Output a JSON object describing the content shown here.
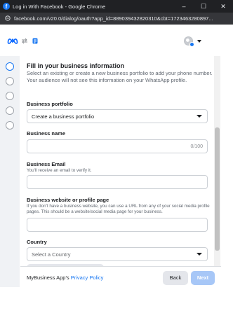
{
  "window": {
    "title": "Log in With Facebook - Google Chrome",
    "controls": {
      "minimize": "–",
      "maximize": "☐",
      "close": "✕"
    }
  },
  "browser": {
    "url": "facebook.com/v20.0/dialog/oauth?app_id=889039432820310&cbt=1723463280897..."
  },
  "header": {
    "logo": "meta-logo",
    "link_icon": "swap-arrows-icon",
    "app_icon": "business-app-icon",
    "account_icon": "avatar"
  },
  "stepper": {
    "steps": [
      {
        "state": "active"
      },
      {
        "state": "inactive"
      },
      {
        "state": "inactive"
      },
      {
        "state": "inactive"
      },
      {
        "state": "inactive"
      }
    ]
  },
  "form": {
    "heading": "Fill in your business information",
    "subtext": "Select an existing or create a new business portfolio to add your phone number. Your audience will not see this information on your WhatsApp profile.",
    "portfolio": {
      "label": "Business portfolio",
      "value": "Create a business portfolio"
    },
    "name": {
      "label": "Business name",
      "value": "",
      "counter": "0/100"
    },
    "email": {
      "label": "Business Email",
      "help": "You'll receive an email to verify it.",
      "value": ""
    },
    "website": {
      "label": "Business website or profile page",
      "help": "If you don't have a business website, you can use a URL from any of your social media profile pages. This should be a website/social media page for your business.",
      "value": ""
    },
    "country": {
      "label": "Country",
      "placeholder": "Select a Country"
    }
  },
  "footer": {
    "text": "MyBusiness App's ",
    "privacy_link": "Privacy Policy",
    "back_label": "Back",
    "next_label": "Next"
  },
  "colors": {
    "accent": "#1877f2",
    "next_disabled": "#a7c7f7",
    "chrome_dark": "#202124"
  }
}
